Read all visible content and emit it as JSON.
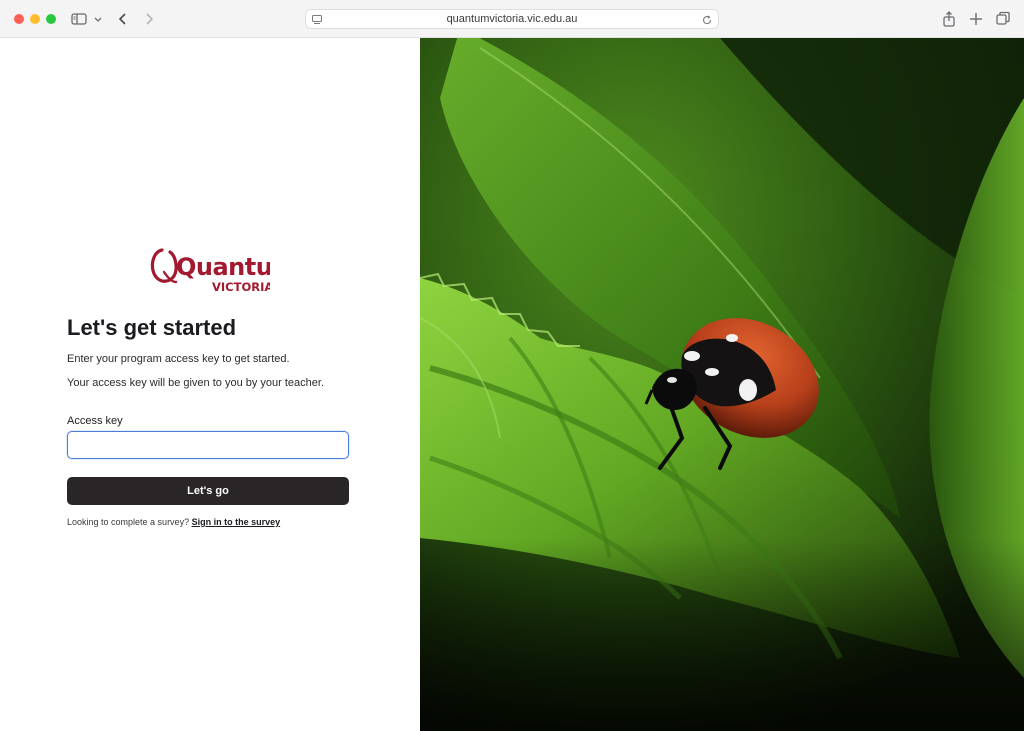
{
  "browser": {
    "url": "quantumvictoria.vic.edu.au"
  },
  "brand": {
    "logo_text_main": "Quantum",
    "logo_text_sub": "VICTORIA",
    "color": "#a3192f"
  },
  "login": {
    "title": "Let's get started",
    "intro_line1": "Enter your program access key to get started.",
    "intro_line2": "Your access key will be given to you by your teacher.",
    "access_key_label": "Access key",
    "access_key_value": "",
    "submit_label": "Let's go",
    "survey_prompt": "Looking to complete a survey?",
    "survey_link": "Sign in to the survey"
  },
  "icons": {
    "sidebar": "sidebar-icon",
    "chevron": "chevron-down-icon",
    "back": "back-icon",
    "forward": "forward-icon",
    "reader": "reader-icon",
    "reload": "reload-icon",
    "share": "share-icon",
    "new_tab": "plus-icon",
    "tabs": "tabs-overview-icon"
  },
  "hero": {
    "subject": "ladybug-on-leaf-photo"
  }
}
